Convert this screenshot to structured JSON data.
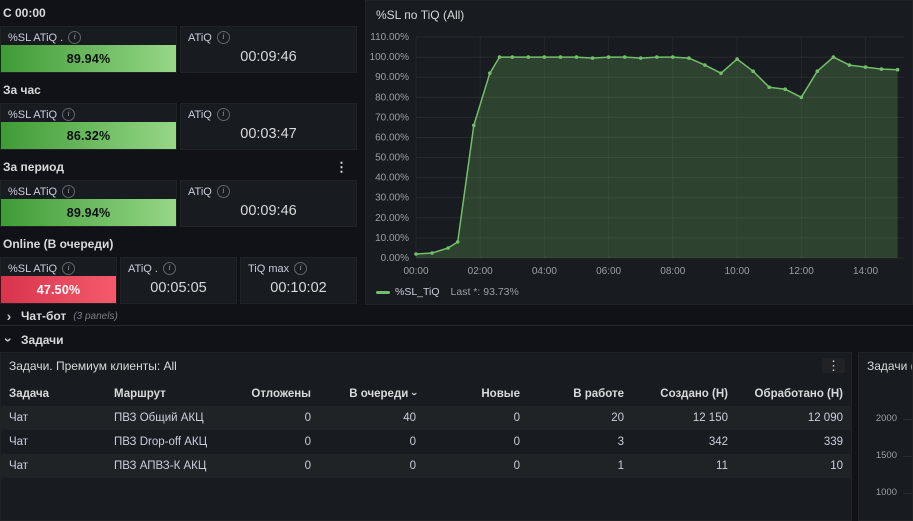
{
  "icons": {
    "info": "i",
    "kebab": "⋮",
    "chevron_right": "›",
    "chevron_down": "›",
    "sort_down": "›"
  },
  "colors": {
    "page_bg": "#111217",
    "panel_bg": "#181b1f",
    "green": "#73bf69",
    "red": "#e0354b"
  },
  "left": {
    "g1": {
      "header": "С 00:00",
      "p1": {
        "title": "%SL ATiQ .",
        "value": "89.94%"
      },
      "p2": {
        "title": "ATiQ",
        "value": "00:09:46"
      }
    },
    "g2": {
      "header": "За час",
      "p1": {
        "title": "%SL ATiQ",
        "value": "86.32%"
      },
      "p2": {
        "title": "ATiQ",
        "value": "00:03:47"
      }
    },
    "g3": {
      "header": "За период",
      "p1": {
        "title": "%SL ATiQ",
        "value": "89.94%"
      },
      "p2": {
        "title": "ATiQ",
        "value": "00:09:46"
      }
    },
    "g4": {
      "header": "Online (В очереди)",
      "p1": {
        "title": "%SL ATiQ",
        "value": "47.50%"
      },
      "p2": {
        "title": "ATiQ .",
        "value": "00:05:05"
      },
      "p3": {
        "title": "TiQ max",
        "value": "00:10:02"
      }
    }
  },
  "chart_data": {
    "type": "area",
    "title": "%SL по TiQ (All)",
    "series_name": "%SL_TiQ",
    "color": "#73bf69",
    "legend": {
      "name": "%SL_TiQ",
      "stat": "Last *: 93.73%"
    },
    "ylim": [
      0,
      110
    ],
    "x_max": 15.2,
    "grid": true,
    "legend_position": "bottom",
    "yticks": [
      {
        "v": 110,
        "label": "110.00%"
      },
      {
        "v": 100,
        "label": "100.00%"
      },
      {
        "v": 90,
        "label": "90.00%"
      },
      {
        "v": 80,
        "label": "80.00%"
      },
      {
        "v": 70,
        "label": "70.00%"
      },
      {
        "v": 60,
        "label": "60.00%"
      },
      {
        "v": 50,
        "label": "50.00%"
      },
      {
        "v": 40,
        "label": "40.00%"
      },
      {
        "v": 30,
        "label": "30.00%"
      },
      {
        "v": 20,
        "label": "20.00%"
      },
      {
        "v": 10,
        "label": "10.00%"
      },
      {
        "v": 0,
        "label": "0.00%"
      }
    ],
    "xticks": [
      {
        "h": 0,
        "label": "00:00"
      },
      {
        "h": 2,
        "label": "02:00"
      },
      {
        "h": 4,
        "label": "04:00"
      },
      {
        "h": 6,
        "label": "06:00"
      },
      {
        "h": 8,
        "label": "08:00"
      },
      {
        "h": 10,
        "label": "10:00"
      },
      {
        "h": 12,
        "label": "12:00"
      },
      {
        "h": 14,
        "label": "14:00"
      }
    ],
    "points": [
      [
        0,
        2
      ],
      [
        0.5,
        2.5
      ],
      [
        1,
        5
      ],
      [
        1.3,
        8
      ],
      [
        1.8,
        66
      ],
      [
        2.3,
        92
      ],
      [
        2.6,
        100
      ],
      [
        3,
        100
      ],
      [
        3.5,
        100
      ],
      [
        4,
        100
      ],
      [
        4.5,
        100
      ],
      [
        5,
        100
      ],
      [
        5.5,
        99.5
      ],
      [
        6,
        100
      ],
      [
        6.5,
        100
      ],
      [
        7,
        99.5
      ],
      [
        7.5,
        100
      ],
      [
        8,
        100
      ],
      [
        8.5,
        99.5
      ],
      [
        9,
        96
      ],
      [
        9.5,
        92
      ],
      [
        10,
        99
      ],
      [
        10.5,
        93
      ],
      [
        11,
        85
      ],
      [
        11.5,
        84
      ],
      [
        12,
        80
      ],
      [
        12.5,
        93
      ],
      [
        13,
        100
      ],
      [
        13.5,
        96
      ],
      [
        14,
        95
      ],
      [
        14.5,
        94
      ],
      [
        15,
        93.73
      ]
    ]
  },
  "rows": {
    "chatbot": {
      "label": "Чат-бот",
      "meta": "(3 panels)"
    },
    "tasks": {
      "label": "Задачи"
    }
  },
  "table": {
    "title": "Задачи. Премиум клиенты: All",
    "sorted_column": "В очереди",
    "columns": [
      "Задача",
      "Маршрут",
      "Отложены",
      "В очереди",
      "Новые",
      "В работе",
      "Создано (Н)",
      "Обработано (Н)"
    ],
    "rows": [
      [
        "Чат",
        "ПВЗ Общий АКЦ",
        "0",
        "40",
        "0",
        "20",
        "12 150",
        "12 090"
      ],
      [
        "Чат",
        "ПВЗ Drop-off АКЦ",
        "0",
        "0",
        "0",
        "3",
        "342",
        "339"
      ],
      [
        "Чат",
        "ПВЗ АПВЗ-К АКЦ",
        "0",
        "0",
        "0",
        "1",
        "11",
        "10"
      ]
    ]
  },
  "mini": {
    "title": "Задачи (",
    "yticks": [
      "2000",
      "1500",
      "1000"
    ]
  }
}
